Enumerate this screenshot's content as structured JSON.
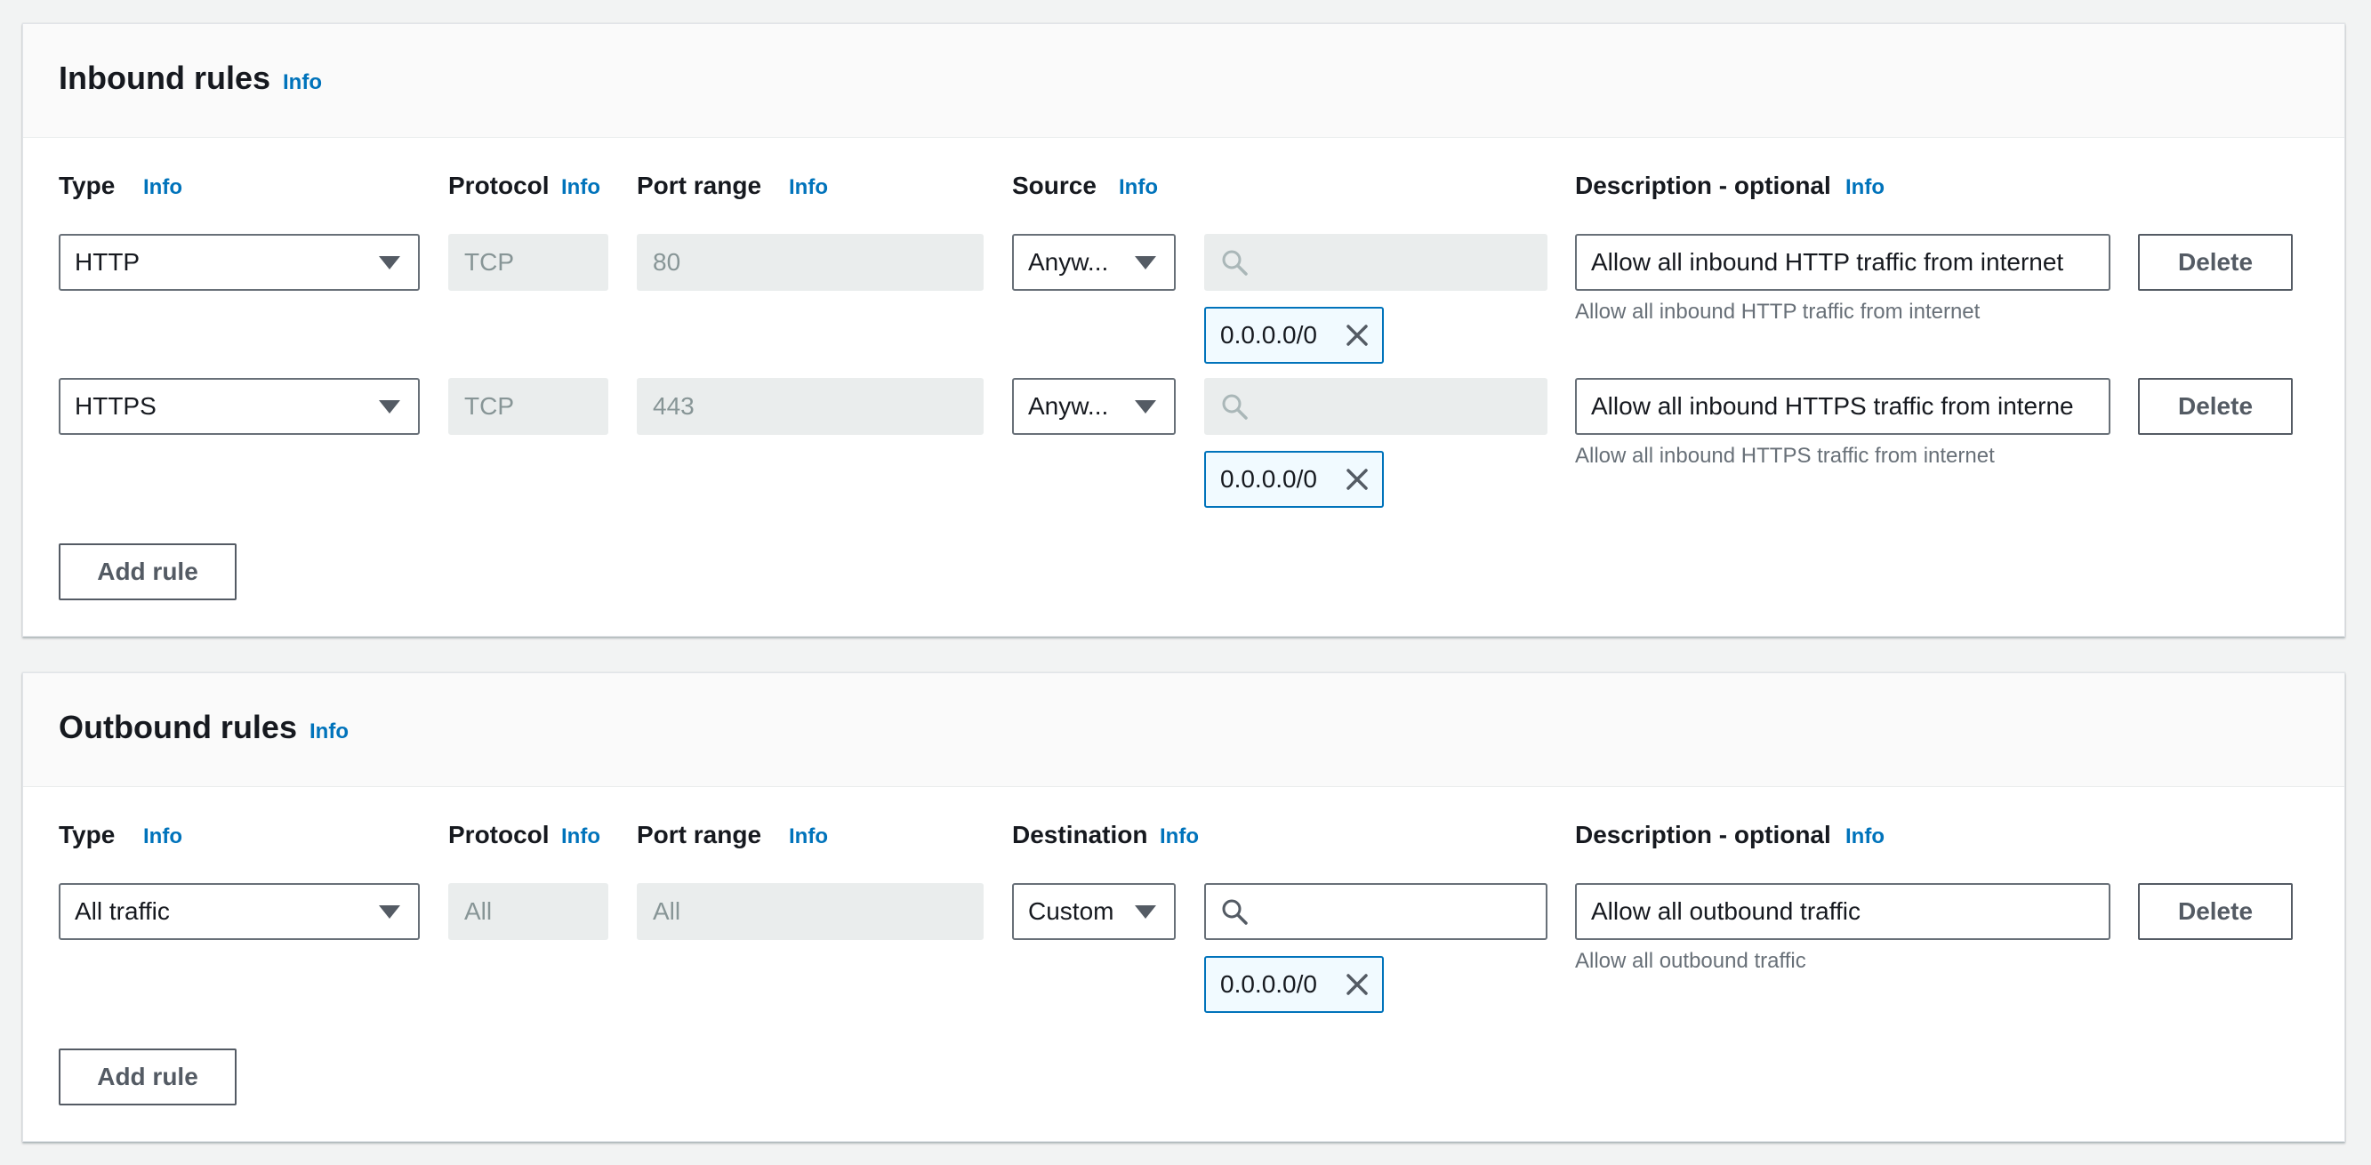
{
  "inbound": {
    "title": "Inbound rules",
    "info": "Info",
    "columns": {
      "type": "Type",
      "type_info": "Info",
      "protocol": "Protocol",
      "protocol_info": "Info",
      "port_range": "Port range",
      "port_info": "Info",
      "source": "Source",
      "source_info": "Info",
      "description": "Description - optional",
      "description_info": "Info"
    },
    "rules": [
      {
        "type": "HTTP",
        "protocol": "TCP",
        "port_range": "80",
        "source": "Anyw...",
        "search_value": "",
        "cidr": "0.0.0.0/0",
        "description": "Allow all inbound HTTP traffic from internet",
        "description_hint": "Allow all inbound HTTP traffic from internet",
        "delete_label": "Delete"
      },
      {
        "type": "HTTPS",
        "protocol": "TCP",
        "port_range": "443",
        "source": "Anyw...",
        "search_value": "",
        "cidr": "0.0.0.0/0",
        "description": "Allow all inbound HTTPS traffic from interne",
        "description_hint": "Allow all inbound HTTPS traffic from internet",
        "delete_label": "Delete"
      }
    ],
    "add_rule_label": "Add rule"
  },
  "outbound": {
    "title": "Outbound rules",
    "info": "Info",
    "columns": {
      "type": "Type",
      "type_info": "Info",
      "protocol": "Protocol",
      "protocol_info": "Info",
      "port_range": "Port range",
      "port_info": "Info",
      "destination": "Destination",
      "destination_info": "Info",
      "description": "Description - optional",
      "description_info": "Info"
    },
    "rules": [
      {
        "type": "All traffic",
        "protocol": "All",
        "port_range": "All",
        "destination": "Custom",
        "search_value": "",
        "cidr": "0.0.0.0/0",
        "description": "Allow all outbound traffic",
        "description_hint": "Allow all outbound traffic",
        "delete_label": "Delete"
      }
    ],
    "add_rule_label": "Add rule"
  },
  "icons": {
    "caret": "caret-down-icon",
    "search": "search-icon",
    "remove": "close-icon"
  },
  "colors": {
    "link": "#0073bb",
    "token_border": "#0073bb",
    "token_bg": "#f1faff",
    "disabled_bg": "#eaeded",
    "page_bg": "#f2f3f3"
  }
}
